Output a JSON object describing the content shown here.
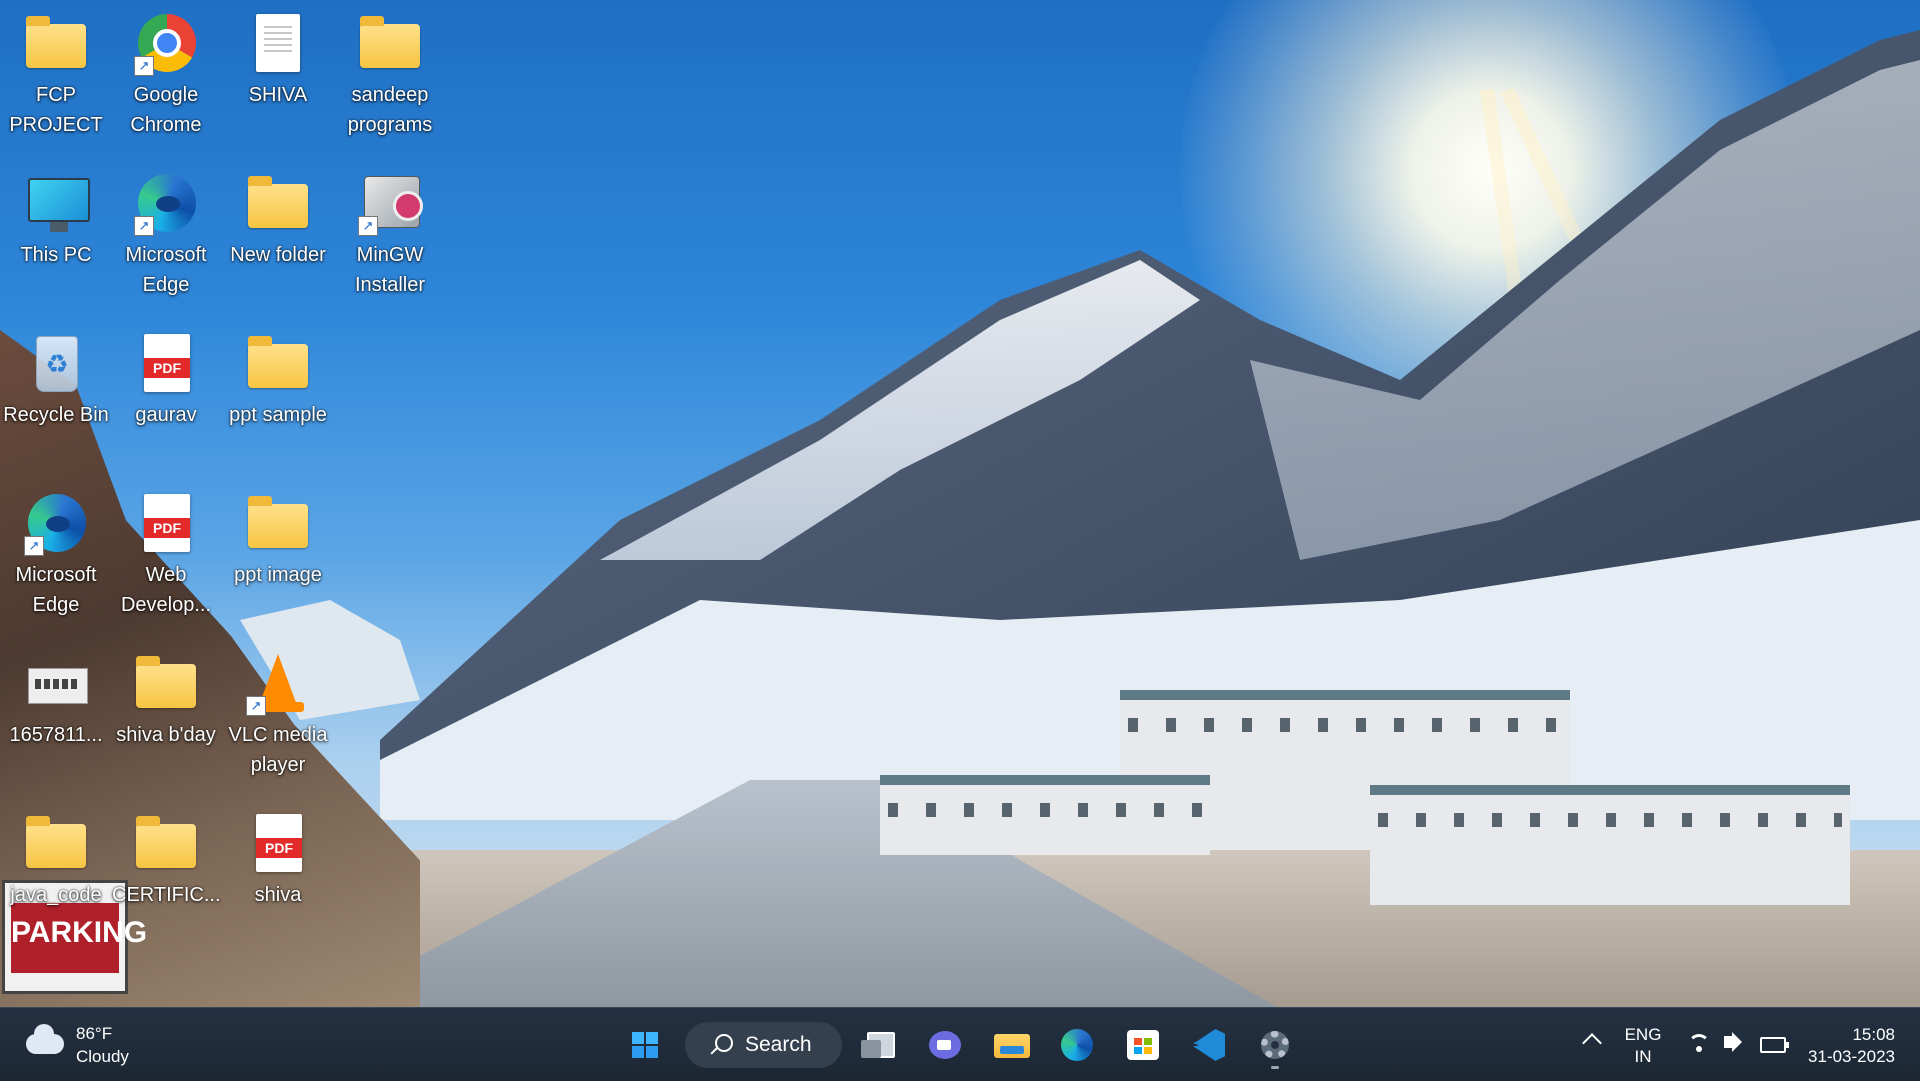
{
  "desktop": {
    "icons": [
      {
        "label": "FCP\nPROJECT",
        "icon": "folder-icon"
      },
      {
        "label": "Google\nChrome",
        "icon": "chrome-icon"
      },
      {
        "label": "SHIVA",
        "icon": "document-icon"
      },
      {
        "label": "sandeep\nprograms",
        "icon": "folder-icon"
      },
      {
        "label": "This PC",
        "icon": "monitor-icon"
      },
      {
        "label": "Microsoft\nEdge",
        "icon": "edge-icon"
      },
      {
        "label": "New folder",
        "icon": "folder-icon"
      },
      {
        "label": "MinGW\nInstaller",
        "icon": "installer-icon"
      },
      {
        "label": "Recycle Bin",
        "icon": "recycle-bin-icon"
      },
      {
        "label": "gaurav",
        "icon": "pdf-icon"
      },
      {
        "label": "ppt sample",
        "icon": "folder-icon"
      },
      {
        "label": "Microsoft\nEdge",
        "icon": "edge-icon"
      },
      {
        "label": "Web\nDevelop...",
        "icon": "pdf-icon"
      },
      {
        "label": "ppt image",
        "icon": "folder-icon"
      },
      {
        "label": "1657811...",
        "icon": "image-thumbnail-icon"
      },
      {
        "label": "shiva b'day",
        "icon": "folder-icon"
      },
      {
        "label": "VLC media\nplayer",
        "icon": "vlc-icon"
      },
      {
        "label": "java_code",
        "icon": "folder-icon"
      },
      {
        "label": "CERTIFIC...",
        "icon": "folder-icon"
      },
      {
        "label": "shiva",
        "icon": "pdf-icon"
      }
    ],
    "pdf_badge": "PDF",
    "wallpaper_sign": "PARKING"
  },
  "taskbar": {
    "weather": {
      "temp": "86°F",
      "condition": "Cloudy",
      "icon": "cloud-icon"
    },
    "search_label": "Search",
    "pinned": [
      {
        "name": "start",
        "icon": "windows-start-icon"
      },
      {
        "name": "task-view",
        "icon": "task-view-icon"
      },
      {
        "name": "teams-chat",
        "icon": "teams-chat-icon"
      },
      {
        "name": "file-explorer",
        "icon": "file-explorer-icon"
      },
      {
        "name": "edge",
        "icon": "edge-icon"
      },
      {
        "name": "microsoft-store",
        "icon": "store-icon"
      },
      {
        "name": "vscode",
        "icon": "vscode-icon"
      },
      {
        "name": "settings",
        "icon": "settings-gear-icon"
      }
    ],
    "tray": {
      "lang_line1": "ENG",
      "lang_line2": "IN",
      "time": "15:08",
      "date": "31-03-2023"
    }
  },
  "colors": {
    "taskbar_bg": "#1f2a35",
    "accent": "#3fb6ff"
  }
}
